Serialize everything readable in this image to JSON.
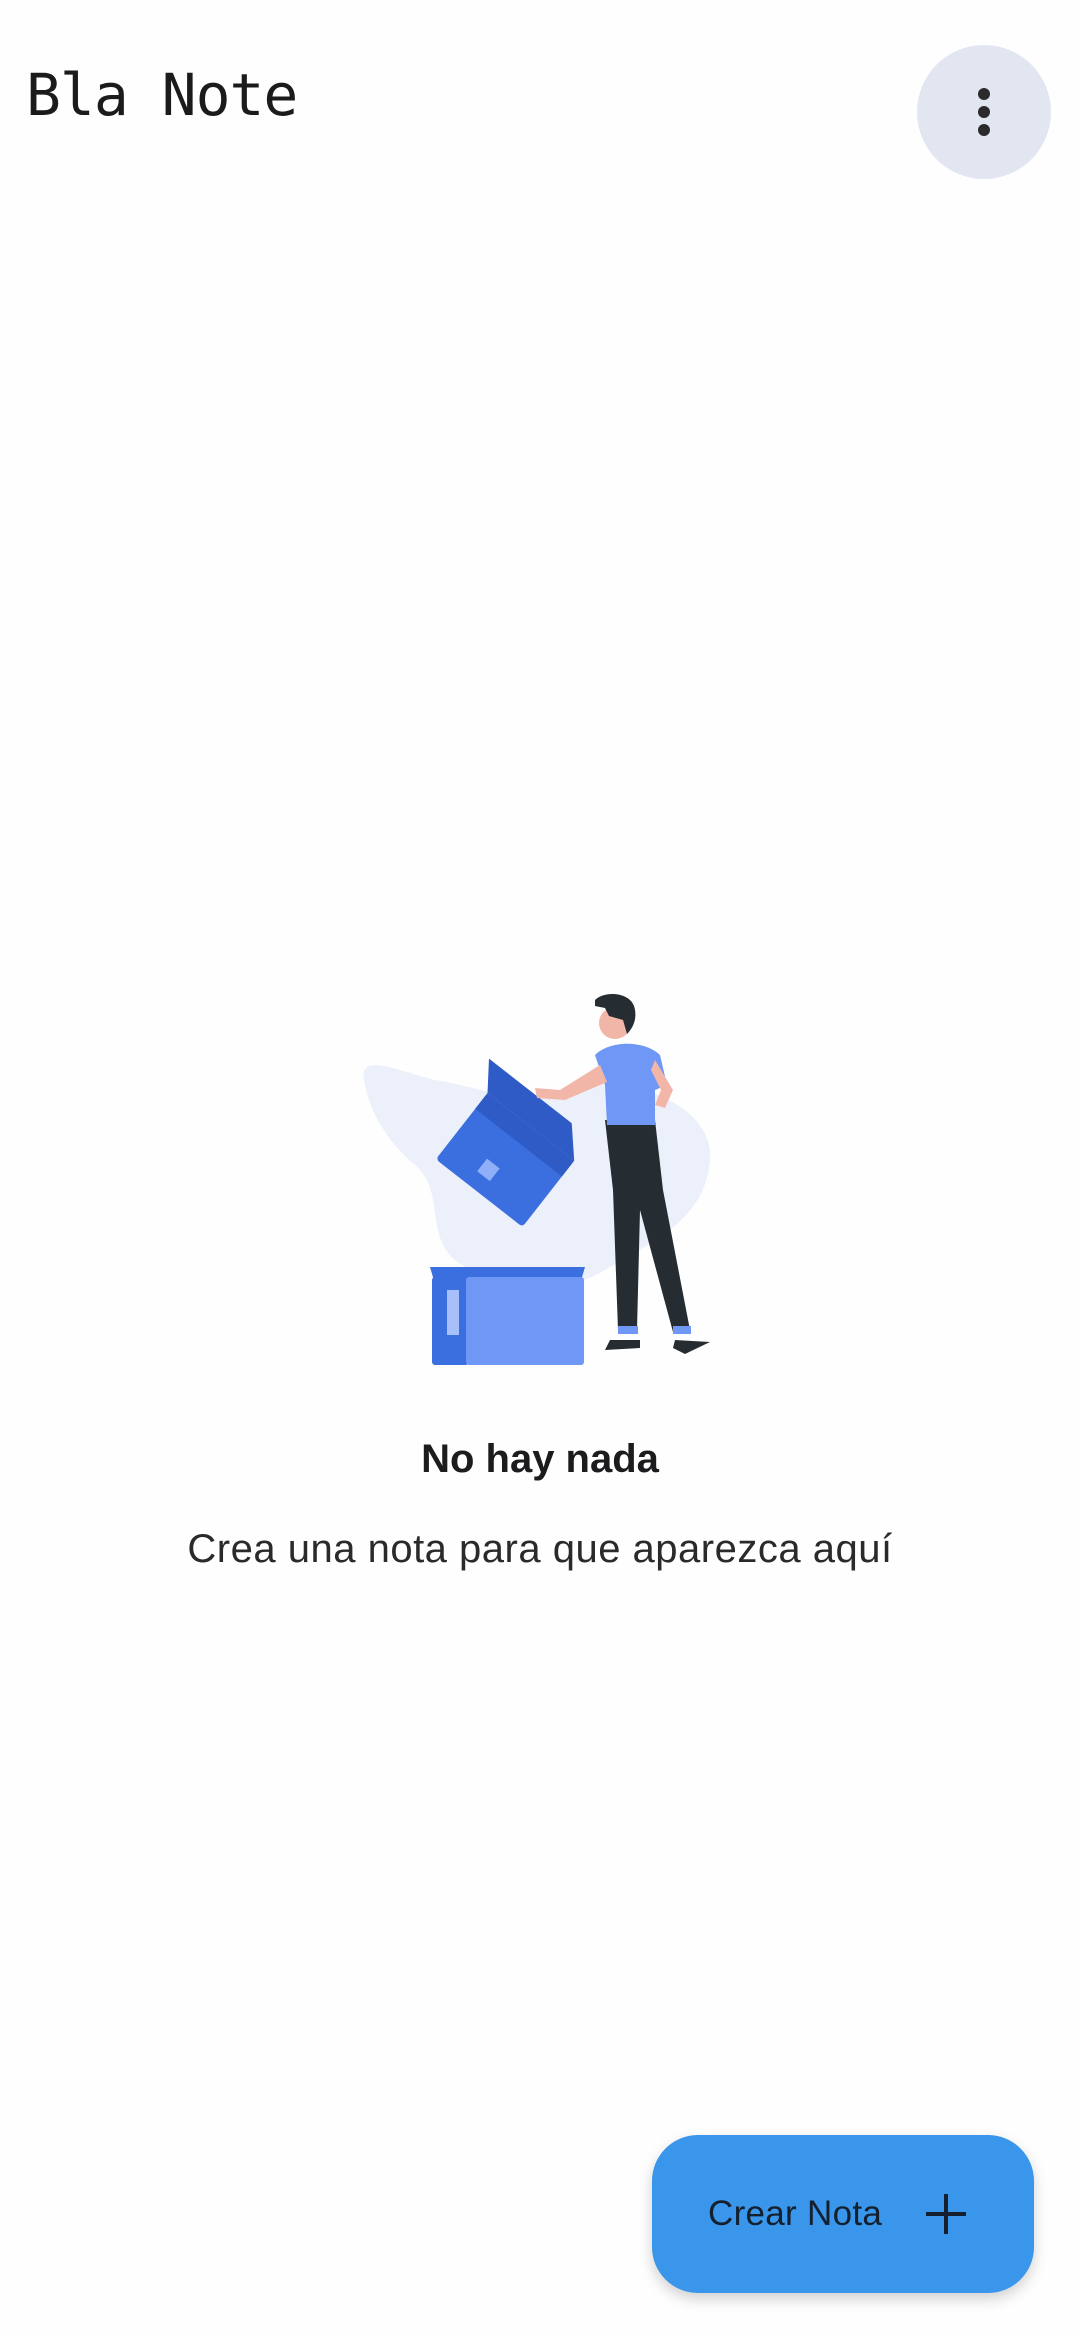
{
  "app": {
    "title": "Bla Note"
  },
  "header": {
    "menu_icon": "more-vert-icon"
  },
  "empty_state": {
    "illustration": "person-emptying-box-illustration",
    "title": "No hay nada",
    "subtitle": "Crea una nota para que aparezca aquí"
  },
  "fab": {
    "label": "Crear Nota",
    "icon": "plus-icon",
    "color": "#3a96ea"
  },
  "colors": {
    "background": "#fefefe",
    "menu_button_bg": "#e2e6f0",
    "illustration_blue": "#3b6fe0",
    "illustration_light_blue": "#6f97f5"
  }
}
